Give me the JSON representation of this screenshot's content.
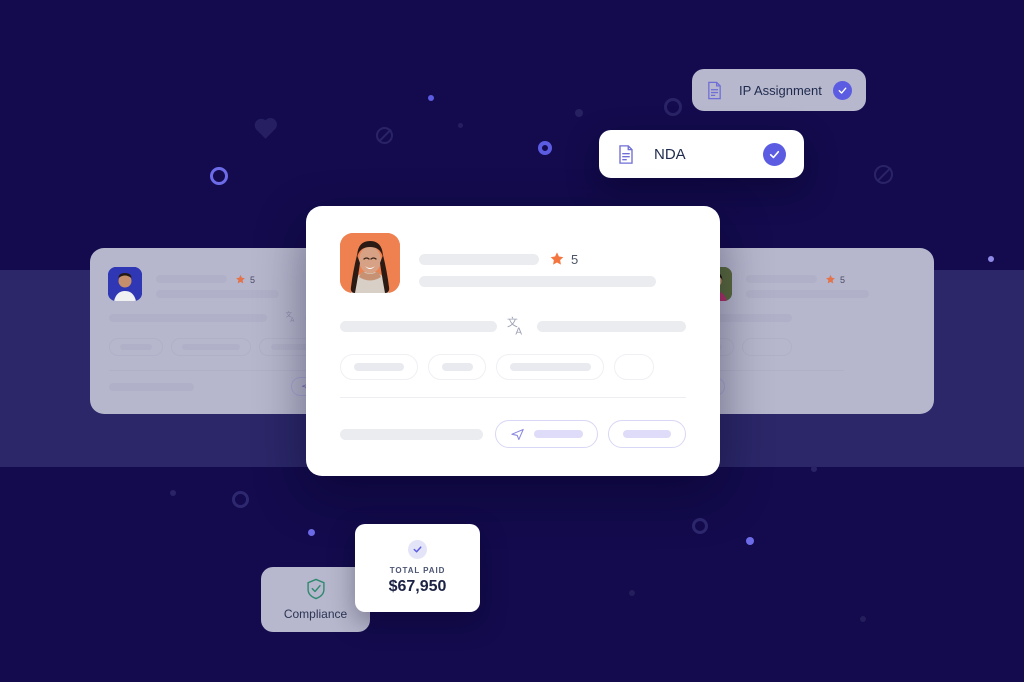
{
  "theme": {
    "background": "#130b4d",
    "band": "#2b2769",
    "accent": "#5b5ce2",
    "star": "#f4753e",
    "shield": "#2f8a6f",
    "avatar_main_bg": "#ef8050",
    "card_surface": "#ffffff",
    "ghost_surface": "#b6b6cd"
  },
  "documents": [
    {
      "name": "ip-assignment",
      "label": "IP Assignment",
      "icon": "document-icon",
      "status_icon": "check-icon",
      "verified": true
    },
    {
      "name": "nda",
      "label": "NDA",
      "icon": "document-icon",
      "status_icon": "check-icon",
      "verified": true
    }
  ],
  "main_card": {
    "avatar": {
      "icon": "avatar-portrait",
      "background": "#ef8050"
    },
    "rating": {
      "icon": "star-icon",
      "value": "5"
    },
    "translate_icon": "translate-icon",
    "send_icon": "send-icon"
  },
  "ghost_cards": [
    {
      "name": "profile-card-left",
      "rating": "5",
      "avatar_background": "#2f37b5"
    },
    {
      "name": "profile-card-right",
      "rating": "5",
      "avatar_background": "#5b6b3f"
    }
  ],
  "compliance": {
    "icon": "shield-check-icon",
    "label": "Compliance"
  },
  "total_paid": {
    "icon": "check-icon",
    "label": "TOTAL PAID",
    "amount": "$67,950"
  }
}
